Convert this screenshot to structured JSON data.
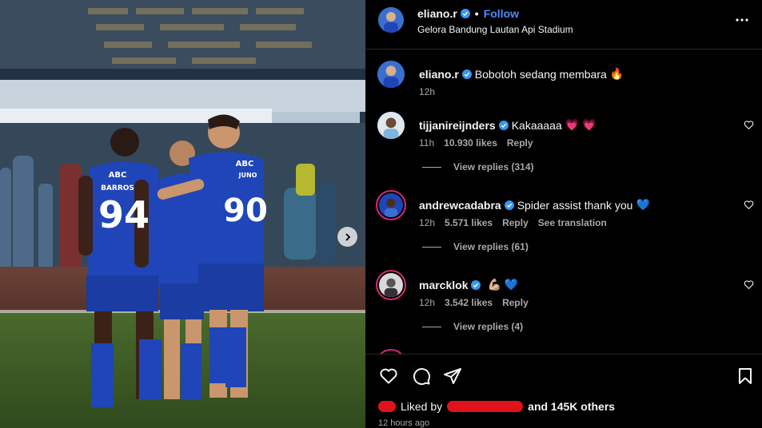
{
  "post": {
    "author": "eliano.r",
    "follow_label": "Follow",
    "location": "Gelora Bandung Lautan Api Stadium",
    "caption": "Bobotoh sedang membara",
    "caption_emoji": "🔥",
    "caption_time": "12h"
  },
  "photo": {
    "player_left_number": "94",
    "player_left_name": "BARROS",
    "player_right_number": "90",
    "player_right_name": "JUNO",
    "sponsor": "ABC",
    "next_icon": "chevron-right-icon"
  },
  "comments": [
    {
      "username": "tijjanireijnders",
      "text": "Kakaaaaa",
      "emoji": "💗 💗",
      "time": "11h",
      "likes": "10.930 likes",
      "reply_label": "Reply",
      "view_replies": "View replies (314)"
    },
    {
      "username": "andrewcadabra",
      "text": "Spider assist thank you",
      "emoji": "💙",
      "time": "12h",
      "likes": "5.571 likes",
      "reply_label": "Reply",
      "translation_label": "See translation",
      "view_replies": "View replies (61)"
    },
    {
      "username": "marcklok",
      "text": "",
      "emoji": "💪🏼 💙",
      "time": "12h",
      "likes": "3.542 likes",
      "reply_label": "Reply",
      "view_replies": "View replies (4)"
    }
  ],
  "footer": {
    "liked_by_prefix": "Liked by",
    "liked_by_suffix": "and 145K others",
    "timestamp": "12 hours ago"
  },
  "colors": {
    "background": "#000000",
    "link_blue": "#4a8cff",
    "muted": "#a8a8a8",
    "jersey_blue": "#1f45b8"
  }
}
